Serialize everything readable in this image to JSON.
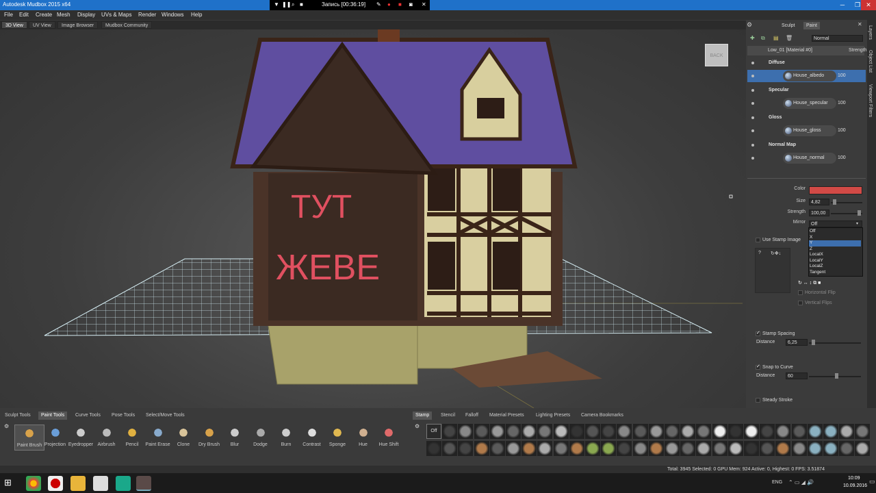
{
  "window": {
    "title": "Autodesk Mudbox 2015 x64",
    "min": "─",
    "max": "❐",
    "close": "✕"
  },
  "recorder": {
    "label": "Запись [00:36:19]"
  },
  "menu": [
    "File",
    "Edit",
    "Create",
    "Mesh",
    "Display",
    "UVs & Maps",
    "Render",
    "Windows",
    "Help"
  ],
  "view_tabs": [
    "3D View",
    "UV View",
    "Image Browser",
    "Mudbox Community"
  ],
  "viewport": {
    "back_label": "BACK",
    "wall_text_line1": "ТУТ",
    "wall_text_line2": "ЖЕВЕ"
  },
  "panel": {
    "tabs": [
      "Sculpt",
      "Paint"
    ],
    "blend_mode": "Normal",
    "material": "Low_01 [Material #0]",
    "strength_col": "Strength",
    "layers": [
      {
        "group": "Diffuse",
        "name": "House_albedo",
        "value": "100"
      },
      {
        "group": "Specular",
        "name": "House_specular",
        "value": "100"
      },
      {
        "group": "Gloss",
        "name": "House_gloss",
        "value": "100"
      },
      {
        "group": "Normal Map",
        "name": "House_normal",
        "value": "100"
      }
    ],
    "side_tabs": [
      "Layers",
      "Object List",
      "Viewport Filters"
    ]
  },
  "properties": {
    "color_label": "Color",
    "color_value": "#d24a46",
    "size_label": "Size",
    "size_value": "4,82",
    "strength_label": "Strength",
    "strength_value": "100,00",
    "mirror_label": "Mirror",
    "mirror_value": "Off",
    "mirror_options": [
      "Off",
      "X",
      "Y",
      "Z",
      "LocalX",
      "LocalY",
      "LocalZ",
      "Tangent"
    ],
    "mirror_selected": "Y",
    "use_stamp_image": "Use Stamp Image",
    "horizontal_flip": "Horizontal Flip",
    "vertical_flip": "Vertical Flips",
    "stamp_spacing": "Stamp Spacing",
    "stamp_distance_label": "Distance",
    "stamp_distance_value": "6,25",
    "snap_to_curve": "Snap to Curve",
    "snap_distance_label": "Distance",
    "snap_distance_value": "60",
    "steady_stroke": "Steady Stroke"
  },
  "tool_tabs": [
    "Sculpt Tools",
    "Paint Tools",
    "Curve Tools",
    "Pose Tools",
    "Select/Move Tools"
  ],
  "tools": [
    {
      "label": "Paint Brush",
      "icon": "paint-brush-icon"
    },
    {
      "label": "Projection",
      "icon": "projection-icon"
    },
    {
      "label": "Eyedropper",
      "icon": "eyedropper-icon"
    },
    {
      "label": "Airbrush",
      "icon": "airbrush-icon"
    },
    {
      "label": "Pencil",
      "icon": "pencil-icon"
    },
    {
      "label": "Paint Erase",
      "icon": "eraser-icon"
    },
    {
      "label": "Clone",
      "icon": "clone-icon"
    },
    {
      "label": "Dry Brush",
      "icon": "dry-brush-icon"
    },
    {
      "label": "Blur",
      "icon": "blur-icon"
    },
    {
      "label": "Dodge",
      "icon": "dodge-icon"
    },
    {
      "label": "Burn",
      "icon": "burn-icon"
    },
    {
      "label": "Contrast",
      "icon": "contrast-icon"
    },
    {
      "label": "Sponge",
      "icon": "sponge-icon"
    },
    {
      "label": "Hue",
      "icon": "hue-icon"
    },
    {
      "label": "Hue Shift",
      "icon": "hue-shift-icon"
    }
  ],
  "stamp_tabs": [
    "Stamp",
    "Stencil",
    "Falloff",
    "Material Presets",
    "Lighting Presets",
    "Camera Bookmarks"
  ],
  "stamp_off": "Off",
  "status": "Total: 3945  Selected: 0  GPU Mem: 924  Active: 0, Highest: 0  FPS: 3.51874",
  "taskbar": {
    "lang": "ENG",
    "time": "10:09",
    "date": "10.09.2016"
  }
}
